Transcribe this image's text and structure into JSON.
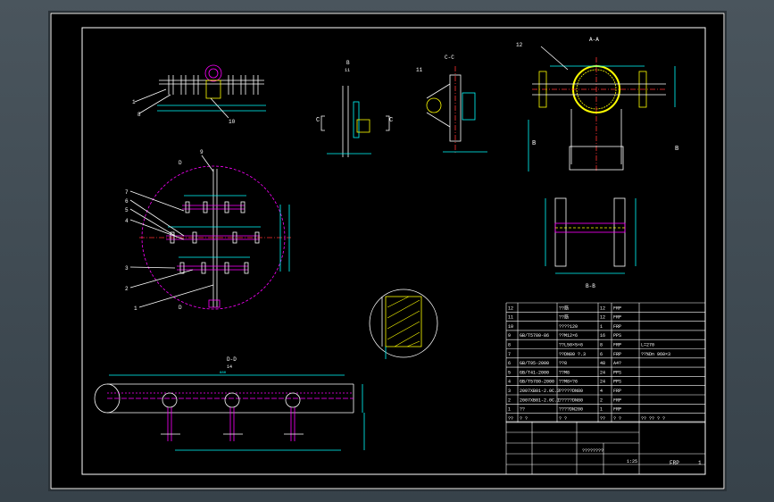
{
  "app": {
    "title": "CAD drawing viewer"
  },
  "colors": {
    "canvas_bg": "#000000",
    "frame": "#ffffff",
    "cyan": "#00ffff",
    "magenta": "#ff00ff",
    "yellow": "#ffff00",
    "red": "#ff3030",
    "green": "#00ff00"
  },
  "views": {
    "section_aa": "A-A",
    "section_bb": "B-B",
    "section_cc": "C-C",
    "section_dd": "D-D",
    "view_b_label": "B",
    "view_c_label": "C",
    "view_d_label": "D",
    "scale_14": "14",
    "scale_11": "11",
    "dim_880": "880"
  },
  "balloons": {
    "main": [
      "9",
      "7",
      "6",
      "5",
      "4",
      "3",
      "2",
      "1"
    ],
    "top": [
      "8",
      "10",
      "1"
    ],
    "side": [
      "12",
      "11",
      "13"
    ]
  },
  "bom": {
    "rows": [
      {
        "no": "12",
        "code": "",
        "name": "??筋",
        "qty": "12",
        "mat": "FRP",
        "note": ""
      },
      {
        "no": "11",
        "code": "",
        "name": "??筋",
        "qty": "12",
        "mat": "FRP",
        "note": ""
      },
      {
        "no": "10",
        "code": "",
        "name": "????120",
        "qty": "1",
        "mat": "FRP",
        "note": ""
      },
      {
        "no": "9",
        "code": "GB/T5780-86",
        "name": "??M12×6",
        "qty": "16",
        "mat": "PPS",
        "note": ""
      },
      {
        "no": "8",
        "code": "",
        "name": "??L50×5×6",
        "qty": "8",
        "mat": "FRP",
        "note": "L=270"
      },
      {
        "no": "7",
        "code": "",
        "name": "??DN80 ?.3",
        "qty": "6",
        "mat": "FRP",
        "note": "??%Dn 960×3"
      },
      {
        "no": "6",
        "code": "GB/T95-2000",
        "name": "??8",
        "qty": "48",
        "mat": "A4?",
        "note": ""
      },
      {
        "no": "5",
        "code": "GB/T41-2000",
        "name": "??M8",
        "qty": "24",
        "mat": "PPS",
        "note": ""
      },
      {
        "no": "4",
        "code": "GB/T5780-2000",
        "name": "??M8×?6",
        "qty": "24",
        "mat": "PPS",
        "note": ""
      },
      {
        "no": "3",
        "code": "2007XB01-2.0C.3",
        "name": "?????DN80",
        "qty": "4",
        "mat": "FRP",
        "note": ""
      },
      {
        "no": "2",
        "code": "2007XB01-2.0C.1",
        "name": "?????DN80",
        "qty": "2",
        "mat": "FRP",
        "note": ""
      },
      {
        "no": "1",
        "code": "??",
        "name": "????DN200",
        "qty": "1",
        "mat": "FRP",
        "note": ""
      },
      {
        "no": "??",
        "code": "? ?",
        "name": "? ?",
        "qty": "??",
        "mat": "? ?",
        "note": "?? ??   ? ?"
      }
    ]
  },
  "title_block": {
    "material": "FRP",
    "sheet": "1",
    "scale": "1:25",
    "tag": "????????"
  }
}
